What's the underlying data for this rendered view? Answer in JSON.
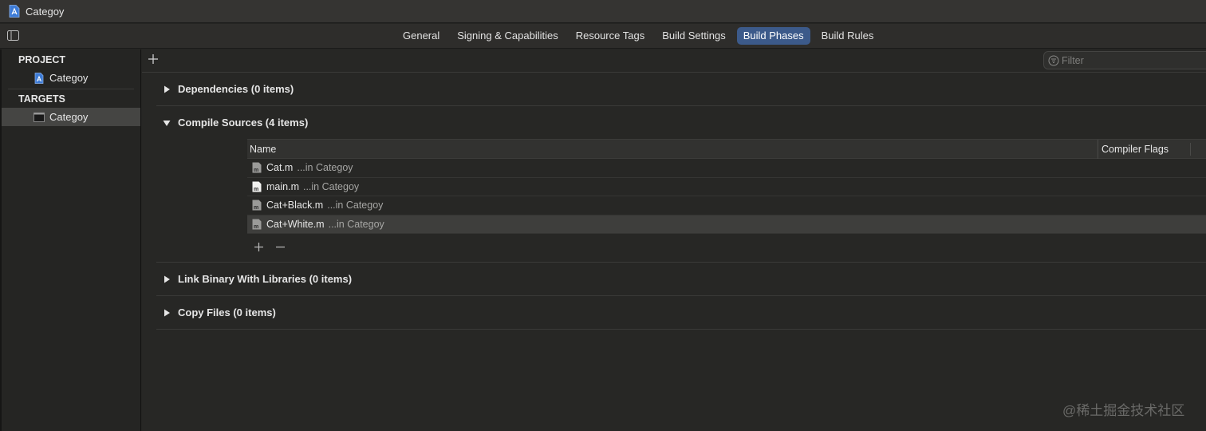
{
  "window": {
    "title": "Categoy",
    "icon": "xcodeproj-icon"
  },
  "tabs": [
    {
      "label": "General"
    },
    {
      "label": "Signing & Capabilities"
    },
    {
      "label": "Resource Tags"
    },
    {
      "label": "Build Settings"
    },
    {
      "label": "Build Phases",
      "active": true
    },
    {
      "label": "Build Rules"
    }
  ],
  "sidebar": {
    "project_header": "PROJECT",
    "project_item": "Categoy",
    "targets_header": "TARGETS",
    "target_item": "Categoy"
  },
  "toolbar": {
    "filter_placeholder": "Filter"
  },
  "phases": {
    "dependencies": "Dependencies (0 items)",
    "compile": "Compile Sources (4 items)",
    "link": "Link Binary With Libraries (0 items)",
    "copy": "Copy Files (0 items)"
  },
  "compile_table": {
    "col_name": "Name",
    "col_flags": "Compiler Flags",
    "rows": [
      {
        "file": "Cat.m",
        "location": "...in Categoy"
      },
      {
        "file": "main.m",
        "location": "...in Categoy"
      },
      {
        "file": "Cat+Black.m",
        "location": "...in Categoy"
      },
      {
        "file": "Cat+White.m",
        "location": "...in Categoy",
        "selected": true
      }
    ]
  },
  "watermark": "@稀土掘金技术社区",
  "colors": {
    "accent": "#3c5a8a",
    "background": "#272725",
    "sidebar_selected": "#454543"
  }
}
